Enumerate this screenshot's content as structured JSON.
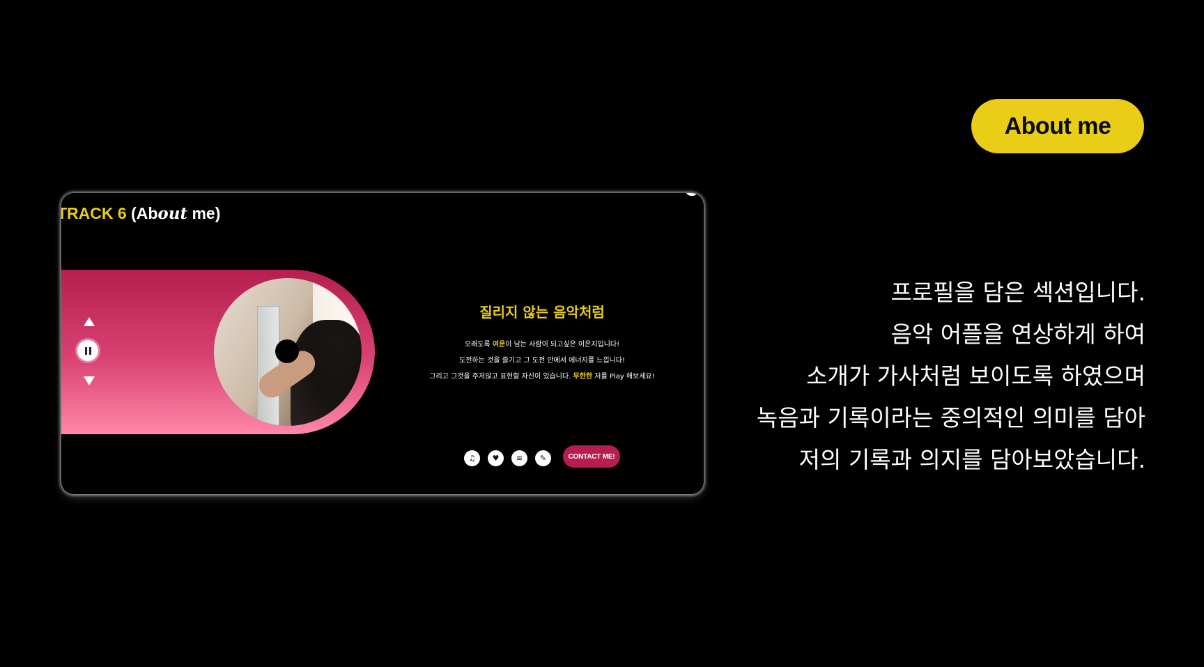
{
  "about_pill": {
    "label": "About me"
  },
  "description": {
    "lines": [
      "프로필을 담은 섹션입니다.",
      "음악 어플을 연상하게 하여",
      "소개가 가사처럼 보이도록 하였으며",
      "녹음과 기록이라는 중의적인 의미를 담아",
      "저의 기록과 의지를 담아보았습니다."
    ]
  },
  "card": {
    "title_track": "TRACK 6",
    "title_open": " (",
    "title_ab": "Ab",
    "title_out": "out",
    "title_rest": " me)",
    "headline": "질리지 않는 음악처럼",
    "lyrics": {
      "line1_pre": "오래도록 ",
      "line1_hl": "여운",
      "line1_post": "이 남는 사람이 되고싶은 이은지입니다!",
      "line2": "도전하는 것을 즐기고 그 도전 안에서 에너지를 느낍니다!",
      "line3_pre": "그리고 그것을 주저않고 표현할 자신이 있습니다. ",
      "line3_hl": "무한한",
      "line3_post": " 저를 Play 해보세요!"
    },
    "contact_label": "CONTACT ME!",
    "icons": [
      "headphones-icon",
      "heart-icon",
      "spotify-icon",
      "edit-icon"
    ],
    "icon_glyphs": [
      "♫",
      "♥",
      "≋",
      "✎"
    ]
  },
  "colors": {
    "accent_yellow": "#e9cd16",
    "accent_pink": "#b51e4e",
    "gradient_light_pink": "#ff87a8",
    "background": "#000000"
  }
}
